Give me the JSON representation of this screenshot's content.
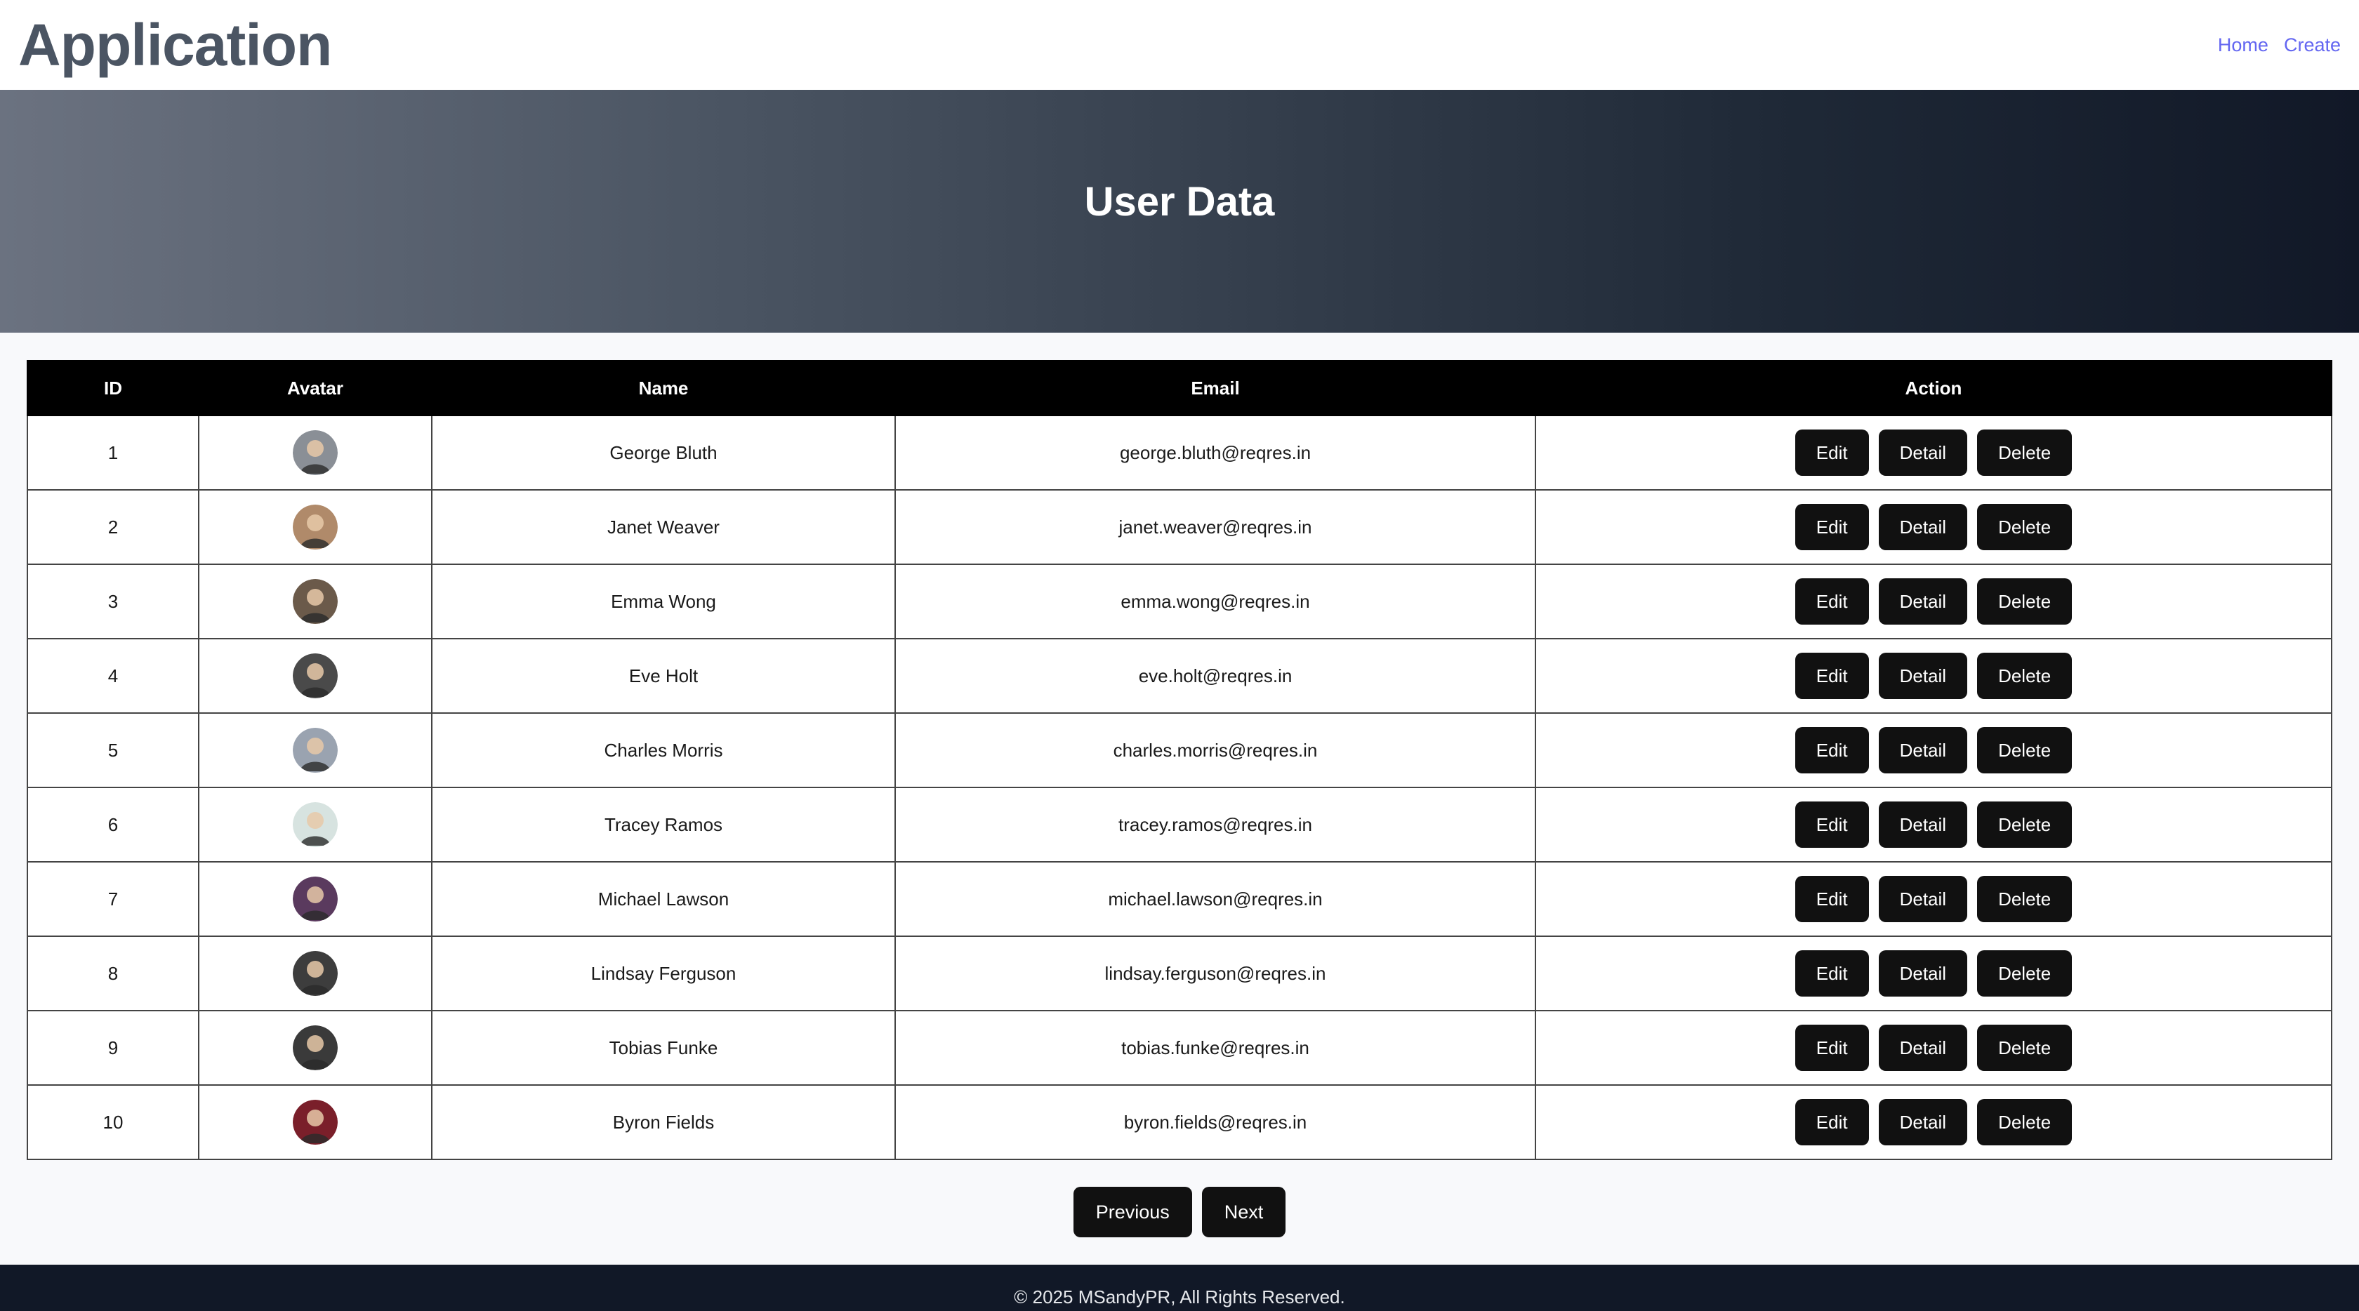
{
  "header": {
    "brand": "Application",
    "nav": [
      "Home",
      "Create"
    ]
  },
  "hero": {
    "title": "User Data"
  },
  "table": {
    "columns": [
      "ID",
      "Avatar",
      "Name",
      "Email",
      "Action"
    ],
    "rows": [
      {
        "id": "1",
        "name": "George Bluth",
        "email": "george.bluth@reqres.in",
        "avatar_color": "#8a8f96"
      },
      {
        "id": "2",
        "name": "Janet Weaver",
        "email": "janet.weaver@reqres.in",
        "avatar_color": "#b08a6a"
      },
      {
        "id": "3",
        "name": "Emma Wong",
        "email": "emma.wong@reqres.in",
        "avatar_color": "#6b5a4a"
      },
      {
        "id": "4",
        "name": "Eve Holt",
        "email": "eve.holt@reqres.in",
        "avatar_color": "#4a4a4a"
      },
      {
        "id": "5",
        "name": "Charles Morris",
        "email": "charles.morris@reqres.in",
        "avatar_color": "#9aa3b0"
      },
      {
        "id": "6",
        "name": "Tracey Ramos",
        "email": "tracey.ramos@reqres.in",
        "avatar_color": "#d7e3e0"
      },
      {
        "id": "7",
        "name": "Michael Lawson",
        "email": "michael.lawson@reqres.in",
        "avatar_color": "#5a3a5e"
      },
      {
        "id": "8",
        "name": "Lindsay Ferguson",
        "email": "lindsay.ferguson@reqres.in",
        "avatar_color": "#3d3d3d"
      },
      {
        "id": "9",
        "name": "Tobias Funke",
        "email": "tobias.funke@reqres.in",
        "avatar_color": "#3a3a3a"
      },
      {
        "id": "10",
        "name": "Byron Fields",
        "email": "byron.fields@reqres.in",
        "avatar_color": "#7a1f2a"
      }
    ],
    "actions": [
      "Edit",
      "Detail",
      "Delete"
    ]
  },
  "pagination": {
    "previous": "Previous",
    "next": "Next"
  },
  "footer": {
    "text": "© 2025 MSandyPR, All Rights Reserved."
  },
  "colors": {
    "brand_text": "#4b5563",
    "nav_link": "#6366f1",
    "button_bg": "#111111",
    "footer_bg": "#111827"
  }
}
